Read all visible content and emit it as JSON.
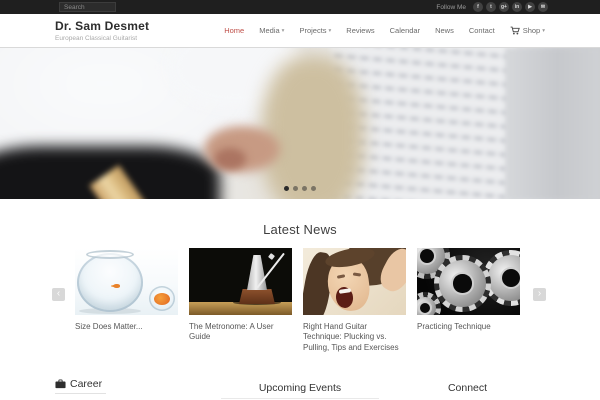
{
  "topbar": {
    "search_placeholder": "Search",
    "follow_label": "Follow Me",
    "social": [
      {
        "name": "facebook",
        "glyph": "f"
      },
      {
        "name": "twitter",
        "glyph": "t"
      },
      {
        "name": "googleplus",
        "glyph": "g+"
      },
      {
        "name": "linkedin",
        "glyph": "in"
      },
      {
        "name": "youtube",
        "glyph": "▶"
      },
      {
        "name": "email",
        "glyph": "✉"
      }
    ]
  },
  "header": {
    "site_title": "Dr. Sam Desmet",
    "tagline": "European Classical Guitarist",
    "nav": [
      {
        "label": "Home",
        "active": true
      },
      {
        "label": "Media",
        "dropdown": true
      },
      {
        "label": "Projects",
        "dropdown": true
      },
      {
        "label": "Reviews"
      },
      {
        "label": "Calendar"
      },
      {
        "label": "News"
      },
      {
        "label": "Contact"
      },
      {
        "label": "Shop",
        "dropdown": true,
        "icon": "cart-icon"
      }
    ],
    "accent_color": "#bf4f48"
  },
  "hero": {
    "slide_count": 4,
    "active_slide": 1,
    "description": "blurred photo of guitarist hand over guitar neck with sheet music"
  },
  "news": {
    "section_title": "Latest News",
    "items": [
      {
        "title": "Size Does Matter...",
        "image": "fishbowls-photo"
      },
      {
        "title": "The Metronome: A User Guide",
        "image": "metronome-photo"
      },
      {
        "title": "Right Hand Guitar Technique: Plucking vs. Pulling, Tips and Exercises",
        "image": "screaming-woman-photo"
      },
      {
        "title": "Practicing Technique",
        "image": "gears-photo"
      }
    ]
  },
  "footer": {
    "widgets": [
      {
        "title": "Career",
        "icon": "briefcase-icon"
      },
      {
        "title": "Upcoming Events"
      },
      {
        "title": "Connect"
      }
    ]
  },
  "colors": {
    "topbar_bg": "#1f1f1f",
    "accent": "#bf4f48",
    "body_bg": "#ffffff"
  }
}
